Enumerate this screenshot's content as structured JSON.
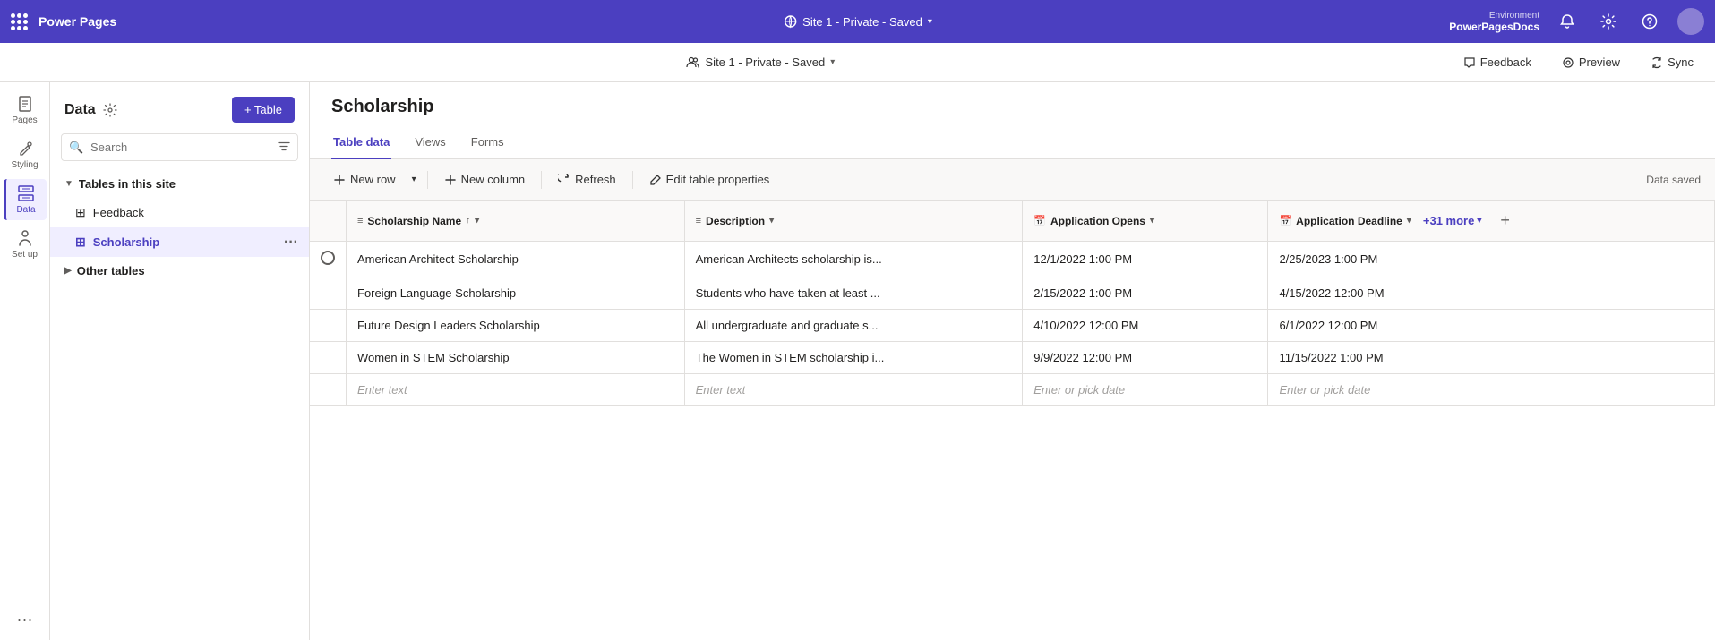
{
  "topNav": {
    "appName": "Power Pages",
    "siteInfo": "Site 1 - Private - Saved",
    "environment": {
      "label": "Environment",
      "name": "PowerPagesDocs"
    },
    "feedbackLabel": "Feedback",
    "previewLabel": "Preview",
    "syncLabel": "Sync"
  },
  "leftRail": {
    "items": [
      {
        "id": "pages",
        "label": "Pages",
        "icon": "pages"
      },
      {
        "id": "styling",
        "label": "Styling",
        "icon": "styling"
      },
      {
        "id": "data",
        "label": "Data",
        "icon": "data",
        "active": true
      },
      {
        "id": "setup",
        "label": "Set up",
        "icon": "setup"
      }
    ]
  },
  "sidebar": {
    "title": "Data",
    "addTableLabel": "+ Table",
    "search": {
      "placeholder": "Search"
    },
    "tablesInThisSite": {
      "label": "Tables in this site",
      "tables": [
        {
          "id": "feedback",
          "name": "Feedback",
          "active": false
        },
        {
          "id": "scholarship",
          "name": "Scholarship",
          "active": true
        }
      ]
    },
    "otherTables": {
      "label": "Other tables",
      "collapsed": true
    }
  },
  "content": {
    "pageTitle": "Scholarship",
    "tabs": [
      {
        "id": "tabledata",
        "label": "Table data",
        "active": true
      },
      {
        "id": "views",
        "label": "Views",
        "active": false
      },
      {
        "id": "forms",
        "label": "Forms",
        "active": false
      }
    ],
    "toolbar": {
      "newRowLabel": "New row",
      "newColumnLabel": "New column",
      "refreshLabel": "Refresh",
      "editTablePropertiesLabel": "Edit table properties",
      "dataSavedLabel": "Data saved"
    },
    "table": {
      "columns": [
        {
          "id": "name",
          "label": "Scholarship Name",
          "type": "text",
          "sortable": true
        },
        {
          "id": "description",
          "label": "Description",
          "type": "text",
          "sortable": false
        },
        {
          "id": "appopens",
          "label": "Application Opens",
          "type": "date",
          "sortable": false
        },
        {
          "id": "appdeadline",
          "label": "Application Deadline",
          "type": "date",
          "sortable": false
        }
      ],
      "moreColumnsLabel": "+31 more",
      "rows": [
        {
          "name": "American Architect Scholarship",
          "description": "American Architects scholarship is...",
          "appopens": "12/1/2022 1:00 PM",
          "appdeadline": "2/25/2023 1:00 PM"
        },
        {
          "name": "Foreign Language Scholarship",
          "description": "Students who have taken at least ...",
          "appopens": "2/15/2022 1:00 PM",
          "appdeadline": "4/15/2022 12:00 PM"
        },
        {
          "name": "Future Design Leaders Scholarship",
          "description": "All undergraduate and graduate s...",
          "appopens": "4/10/2022 12:00 PM",
          "appdeadline": "6/1/2022 12:00 PM"
        },
        {
          "name": "Women in STEM Scholarship",
          "description": "The Women in STEM scholarship i...",
          "appopens": "9/9/2022 12:00 PM",
          "appdeadline": "11/15/2022 1:00 PM"
        }
      ],
      "newRow": {
        "namePlaceholder": "Enter text",
        "descriptionPlaceholder": "Enter text",
        "appopensPlaceholder": "Enter or pick date",
        "appdeadlinePlaceholder": "Enter or pick date"
      }
    }
  }
}
